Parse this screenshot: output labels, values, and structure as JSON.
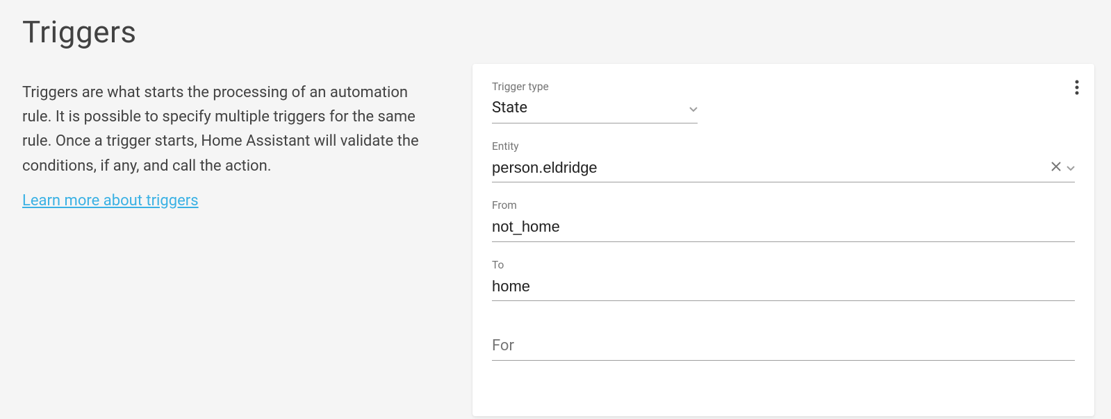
{
  "section": {
    "title": "Triggers",
    "description": "Triggers are what starts the processing of an automation rule. It is possible to specify multiple triggers for the same rule. Once a trigger starts, Home Assistant will validate the conditions, if any, and call the action.",
    "learn_more": "Learn more about triggers"
  },
  "card": {
    "trigger_type": {
      "label": "Trigger type",
      "value": "State"
    },
    "entity": {
      "label": "Entity",
      "value": "person.eldridge"
    },
    "from": {
      "label": "From",
      "value": "not_home"
    },
    "to": {
      "label": "To",
      "value": "home"
    },
    "for": {
      "label": "For",
      "value": ""
    }
  }
}
